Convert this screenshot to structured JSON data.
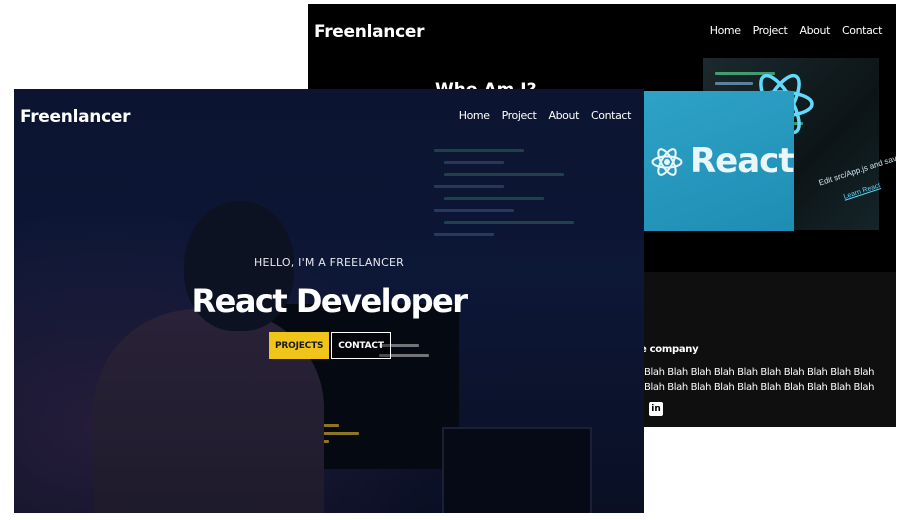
{
  "back_window": {
    "brand": "Freenlancer",
    "nav": [
      "Home",
      "Project",
      "About",
      "Contact"
    ],
    "section_title": "Who Am I?",
    "banner_word": "React",
    "edit_note": "Edit src/App.js and save to reload.",
    "learn_link": "Learn React",
    "company_line": "e company",
    "blah_lines": [
      "Blah Blah Blah Blah Blah Blah Blah Blah Blah Blah",
      "Blah Blah Blah Blah Blah Blah Blah Blah Blah Blah"
    ],
    "social_icon": "linkedin-icon",
    "accent": "#61dafb"
  },
  "front_window": {
    "brand": "Freenlancer",
    "nav": [
      "Home",
      "Project",
      "About",
      "Contact"
    ],
    "greeting": "HELLO, I'M A FREELANCER",
    "role": "React Developer",
    "projects_button": "PROJECTS",
    "contact_button": "CONTACT",
    "accent": "#f0c419"
  }
}
